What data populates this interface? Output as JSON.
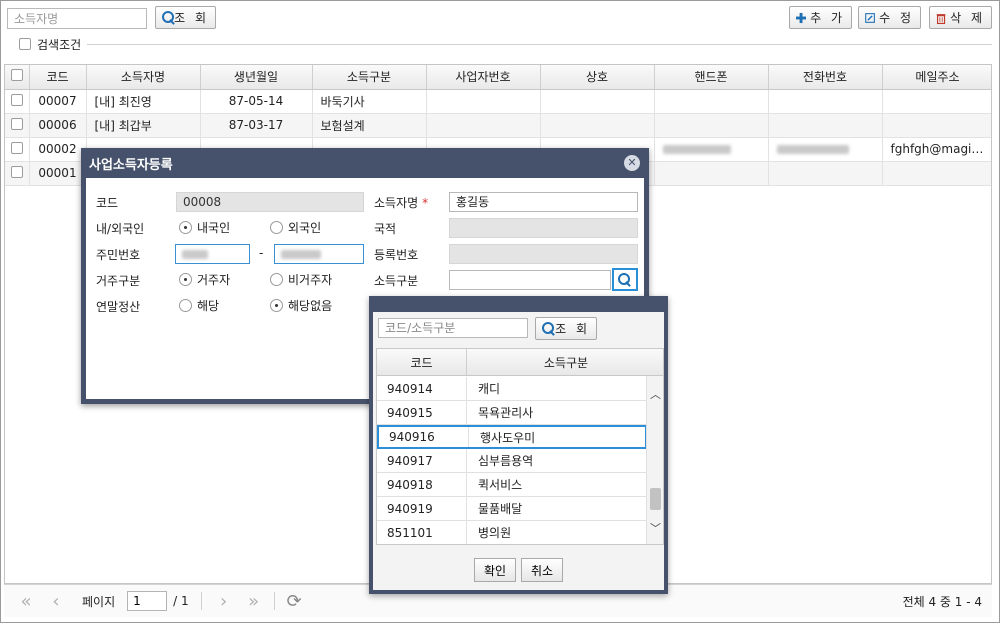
{
  "toolbar": {
    "search_placeholder": "소득자명",
    "search_button": "조 회",
    "add_button": "추 가",
    "edit_button": "수 정",
    "delete_button": "삭 제"
  },
  "search_condition": {
    "label": "검색조건"
  },
  "table": {
    "headers": [
      "코드",
      "소득자명",
      "생년월일",
      "소득구분",
      "사업자번호",
      "상호",
      "핸드폰",
      "전화번호",
      "메일주소"
    ],
    "rows": [
      {
        "code": "00007",
        "name": "[내] 최진영",
        "birth": "87-05-14",
        "income_type": "바둑기사",
        "email": ""
      },
      {
        "code": "00006",
        "name": "[내] 최갑부",
        "birth": "87-03-17",
        "income_type": "보험설계",
        "email": ""
      },
      {
        "code": "00002",
        "name": "",
        "birth": "",
        "income_type": "",
        "email": "fghfgh@magi…"
      },
      {
        "code": "00001",
        "name": "",
        "birth": "",
        "income_type": "",
        "email": ""
      }
    ]
  },
  "pager": {
    "page_label": "페이지",
    "page_value": "1",
    "total_pages": "/ 1",
    "summary": "전체 4 중 1 - 4"
  },
  "dialog": {
    "title": "사업소득자등록",
    "close_icon": "close-icon",
    "code_label": "코드",
    "code_value": "00008",
    "name_label": "소득자명",
    "name_required": "*",
    "name_value": "홍길동",
    "nationality_type_label": "내/외국인",
    "domestic_label": "내국인",
    "foreign_label": "외국인",
    "nationality_label": "국적",
    "resident_no_label": "주민번호",
    "resident_sep": "-",
    "registration_no_label": "등록번호",
    "residence_label": "거주구분",
    "resident_label": "거주자",
    "nonresident_label": "비거주자",
    "income_type_label": "소득구분",
    "settlement_label": "연말정산",
    "applicable_label": "해당",
    "not_applicable_label": "해당없음"
  },
  "popup": {
    "search_placeholder": "코드/소득구분",
    "search_button": "조 회",
    "col_code": "코드",
    "col_name": "소득구분",
    "rows": [
      {
        "code": "940914",
        "name": "캐디"
      },
      {
        "code": "940915",
        "name": "목욕관리사"
      },
      {
        "code": "940916",
        "name": "행사도우미"
      },
      {
        "code": "940917",
        "name": "심부름용역"
      },
      {
        "code": "940918",
        "name": "퀵서비스"
      },
      {
        "code": "940919",
        "name": "물품배달"
      },
      {
        "code": "851101",
        "name": "병의원"
      }
    ],
    "selected_code": "940916",
    "ok_button": "확인",
    "cancel_button": "취소"
  },
  "colors": {
    "dialog_header": "#46526b",
    "focus_blue": "#2a8fd6",
    "toolbar_icon_blue": "#1f6fb5",
    "delete_icon_red": "#c0392b"
  }
}
